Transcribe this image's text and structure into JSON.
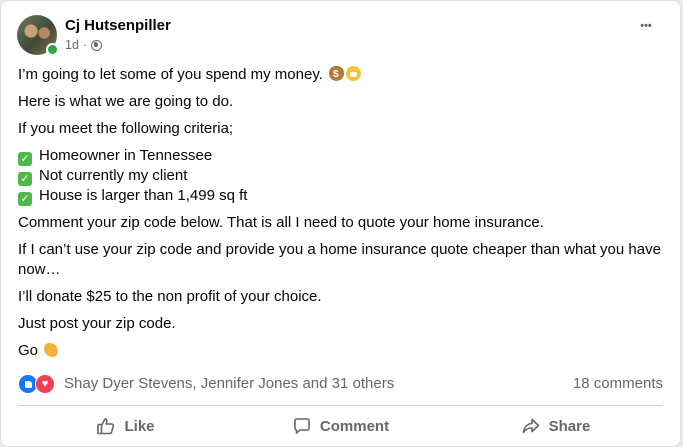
{
  "post": {
    "author": "Cj Hutsenpiller",
    "timestamp": "1d",
    "separator": "·",
    "privacy_icon": "globe-icon",
    "more_icon": "more-horizontal-icon",
    "more_label": "•••",
    "lines": {
      "intro": "I’m going to let some of you spend my money.",
      "plan": "Here is what we are going to do.",
      "criteria_intro": "If you meet the following criteria;",
      "criteria": [
        "Homeowner in Tennessee",
        "Not currently my client",
        "House is larger than 1,499 sq ft"
      ],
      "comment_zip": "Comment your zip code below. That is all I need to quote your home insurance.",
      "condition": "If I can’t use your zip code and provide you a home insurance quote cheaper than what you have now…",
      "donate": "I’ll donate $25 to the non profit of your choice.",
      "just_post": "Just post your zip code.",
      "go": "Go"
    },
    "check_glyph": "✓"
  },
  "reactions": {
    "icons": [
      "like-reaction-icon",
      "love-reaction-icon"
    ],
    "names": "Shay Dyer Stevens, Jennifer Jones and 31 others",
    "comments": "18 comments"
  },
  "actions": {
    "like": "Like",
    "comment": "Comment",
    "share": "Share"
  },
  "colors": {
    "like_blue": "#1877f2",
    "love_red": "#f33e58",
    "online_green": "#31a24c",
    "check_green": "#4fb848",
    "secondary_text": "#65676b"
  }
}
